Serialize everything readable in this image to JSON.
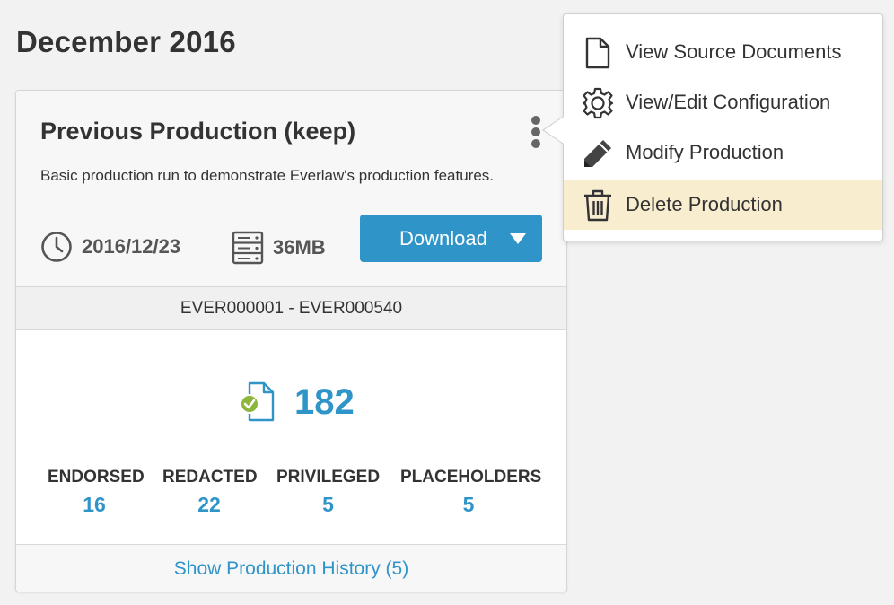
{
  "page": {
    "title": "December 2016"
  },
  "production": {
    "title": "Previous Production (keep)",
    "description": "Basic production run to demonstrate Everlaw's production features.",
    "date": "2016/12/23",
    "size": "36MB",
    "download_label": "Download",
    "bates_range": "EVER000001 - EVER000540",
    "total_docs": "182",
    "stats": [
      {
        "label": "ENDORSED",
        "value": "16"
      },
      {
        "label": "REDACTED",
        "value": "22"
      },
      {
        "label": "PRIVILEGED",
        "value": "5"
      },
      {
        "label": "PLACEHOLDERS",
        "value": "5"
      }
    ],
    "history_link": "Show Production History (5)"
  },
  "menu": {
    "items": [
      {
        "label": "View Source Documents",
        "icon": "document-icon"
      },
      {
        "label": "View/Edit Configuration",
        "icon": "gear-icon"
      },
      {
        "label": "Modify Production",
        "icon": "pencil-icon"
      },
      {
        "label": "Delete Production",
        "icon": "trash-icon",
        "highlighted": true
      }
    ]
  },
  "colors": {
    "accent": "#2f94c8",
    "highlight": "#f8edcf",
    "check": "#8cb63c"
  }
}
